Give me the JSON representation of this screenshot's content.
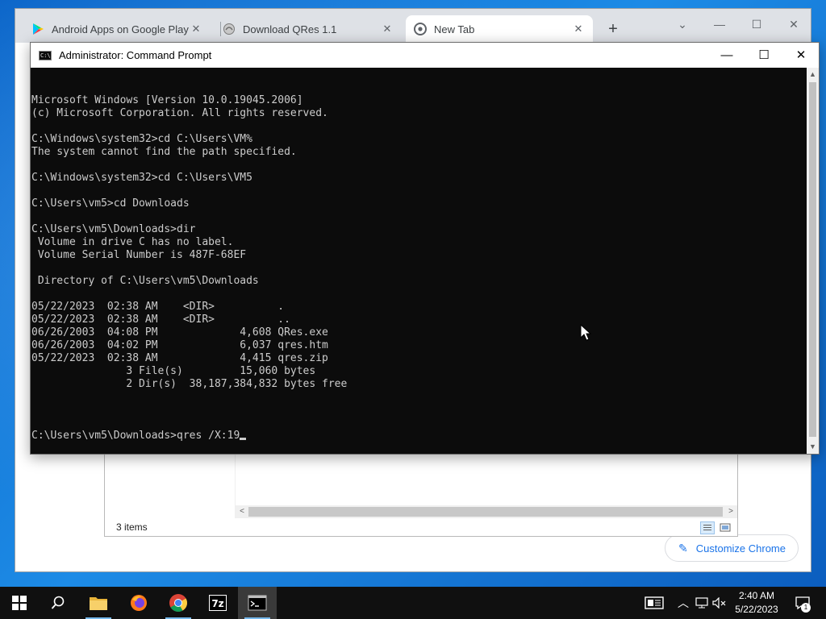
{
  "chrome": {
    "tabs": [
      {
        "label": "Android Apps on Google Play",
        "icon": "google-play-icon"
      },
      {
        "label": "Download QRes 1.1",
        "icon": "qres-site-icon"
      },
      {
        "label": "New Tab",
        "icon": "chrome-icon"
      }
    ],
    "customize_label": "Customize Chrome"
  },
  "explorer": {
    "status": "3 items"
  },
  "cmd": {
    "title": "Administrator: Command Prompt",
    "lines": [
      "Microsoft Windows [Version 10.0.19045.2006]",
      "(c) Microsoft Corporation. All rights reserved.",
      "",
      "C:\\Windows\\system32>cd C:\\Users\\VM%",
      "The system cannot find the path specified.",
      "",
      "C:\\Windows\\system32>cd C:\\Users\\VM5",
      "",
      "C:\\Users\\vm5>cd Downloads",
      "",
      "C:\\Users\\vm5\\Downloads>dir",
      " Volume in drive C has no label.",
      " Volume Serial Number is 487F-68EF",
      "",
      " Directory of C:\\Users\\vm5\\Downloads",
      "",
      "05/22/2023  02:38 AM    <DIR>          .",
      "05/22/2023  02:38 AM    <DIR>          ..",
      "06/26/2003  04:08 PM             4,608 QRes.exe",
      "06/26/2003  04:02 PM             6,037 qres.htm",
      "05/22/2023  02:38 AM             4,415 qres.zip",
      "               3 File(s)         15,060 bytes",
      "               2 Dir(s)  38,187,384,832 bytes free",
      ""
    ],
    "prompt": "C:\\Users\\vm5\\Downloads>qres /X:19"
  },
  "taskbar": {
    "time": "2:40 AM",
    "date": "5/22/2023",
    "notifications": "1"
  }
}
